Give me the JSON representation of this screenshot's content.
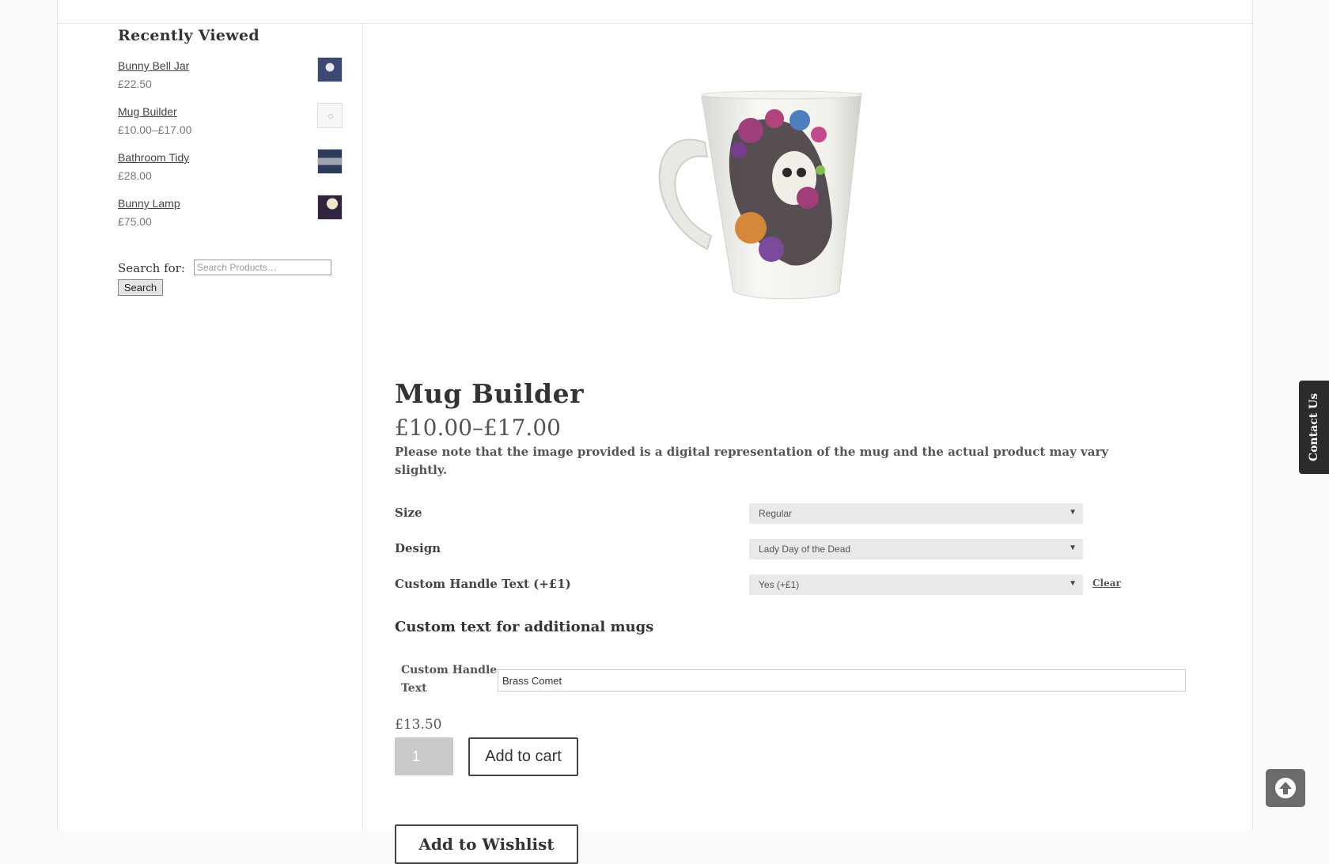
{
  "sidebar": {
    "recently_viewed_title": "Recently Viewed",
    "items": [
      {
        "name": "Bunny Bell Jar",
        "price": "£22.50",
        "thumb_icon": "bunny-bell-jar-thumbnail"
      },
      {
        "name": "Mug Builder",
        "price": "£10.00–£17.00",
        "thumb_icon": "mug-builder-thumbnail"
      },
      {
        "name": "Bathroom Tidy",
        "price": "£28.00",
        "thumb_icon": "bathroom-tidy-thumbnail"
      },
      {
        "name": "Bunny Lamp",
        "price": "£75.00",
        "thumb_icon": "bunny-lamp-thumbnail"
      }
    ],
    "search": {
      "label": "Search for:",
      "placeholder": "Search Products…",
      "button_label": "Search"
    }
  },
  "product": {
    "title": "Mug Builder",
    "price_range": "£10.00–£17.00",
    "note": "Please note that the image provided is a digital representation of the mug and the actual product may vary slightly.",
    "image_icon": "sugar-skull-lady-mug-image",
    "options": [
      {
        "label": "Size",
        "value": "Regular"
      },
      {
        "label": "Design",
        "value": "Lady Day of the Dead"
      },
      {
        "label": "Custom Handle Text (+£1)",
        "value": "Yes (+£1)"
      }
    ],
    "clear_label": "Clear",
    "addon_heading": "Custom text for additional mugs",
    "addon_field_label": "Custom Handle Text",
    "addon_field_value": "Brass Comet",
    "variation_price": "£13.50",
    "quantity": "1",
    "add_to_cart_label": "Add to cart",
    "wishlist_label": "Add to Wishlist"
  },
  "floating": {
    "contact_label": "Contact Us",
    "scroll_top_icon": "arrow-up-circle-icon"
  },
  "colors": {
    "contact_tab_bg": "#2b2b2b",
    "scroll_top_bg": "#6b6b6b",
    "select_bg": "#e9e9e9",
    "quantity_bg": "#c9c9c9"
  }
}
